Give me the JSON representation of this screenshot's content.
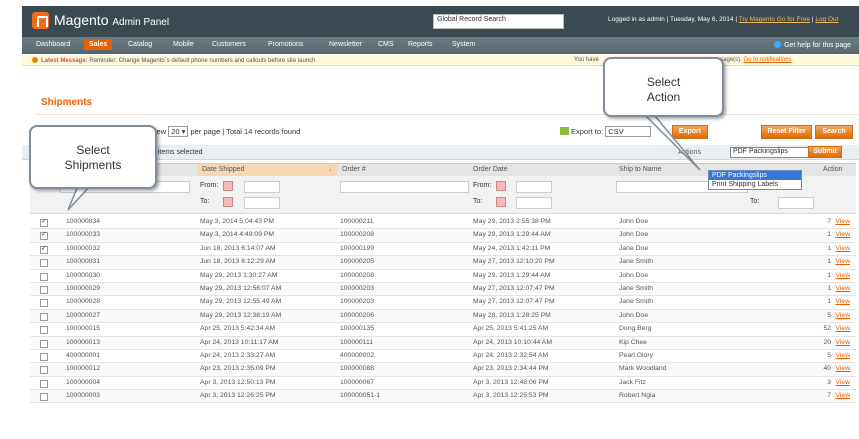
{
  "header": {
    "title": "Magento",
    "title_suffix": "Admin Panel",
    "search_value": "Global Record Search",
    "logged_in": "Logged in as admin",
    "date": "Tuesday, May 6, 2014",
    "try_link": "Try Magento Go for Free",
    "logout": "Log Out"
  },
  "nav": {
    "items": [
      "Dashboard",
      "Sales",
      "Catalog",
      "Mobile",
      "Customers",
      "Promotions",
      "Newsletter",
      "CMS",
      "Reports",
      "System"
    ],
    "active": "Sales",
    "help": "Get help for this page"
  },
  "message": {
    "lead": "Latest Message:",
    "text": "Reminder: Change Magento`s default phone numbers and callouts before site launch",
    "right_text": "You have",
    "right_text2": "unread message(s).",
    "right_link": "Go to notifications"
  },
  "page": {
    "title": "Shipments",
    "pager_view": "View",
    "per_page_value": "20",
    "per_page_label": "per page",
    "total": "Total 14 records found",
    "export_label": "Export to:",
    "export_value": "CSV",
    "export_button": "Export",
    "reset_filter": "Reset Filter",
    "search": "Search",
    "items_selected": "0 items selected",
    "actions_label": "Actions",
    "actions_value": "PDF Packingslips",
    "submit": "Submit",
    "actions_options": [
      "PDF Packingslips",
      "Print Shipping Labels"
    ]
  },
  "grid": {
    "columns": [
      "Date Shipped",
      "Order #",
      "Order Date",
      "Ship to Name",
      "Action"
    ],
    "from_label": "From:",
    "to_label": "To:",
    "rows": [
      {
        "checked": true,
        "id": "100000034",
        "shipped": "May 3, 2014 5:04:43 PM",
        "order": "100000211",
        "order_date": "May 29, 2013 2:55:38 PM",
        "name": "John Doe",
        "qty": "7",
        "action": "View"
      },
      {
        "checked": true,
        "id": "100000033",
        "shipped": "May 3, 2014 4:49:09 PM",
        "order": "100000208",
        "order_date": "May 29, 2013 1:29:44 AM",
        "name": "John Doe",
        "qty": "1",
        "action": "View"
      },
      {
        "checked": true,
        "id": "100000032",
        "shipped": "Jun 18, 2013 6:14:07 AM",
        "order": "100000199",
        "order_date": "May 24, 2013 1:42:11 PM",
        "name": "Jane Doe",
        "qty": "1",
        "action": "View"
      },
      {
        "checked": false,
        "id": "100000031",
        "shipped": "Jun 18, 2013 6:12:29 AM",
        "order": "100000205",
        "order_date": "May 27, 2013 12:10:20 PM",
        "name": "Jane Smith",
        "qty": "1",
        "action": "View"
      },
      {
        "checked": false,
        "id": "100000030",
        "shipped": "May 29, 2013 1:30:27 AM",
        "order": "100000208",
        "order_date": "May 29, 2013 1:29:44 AM",
        "name": "John Doe",
        "qty": "1",
        "action": "View"
      },
      {
        "checked": false,
        "id": "100000029",
        "shipped": "May 29, 2013 12:56:07 AM",
        "order": "100000203",
        "order_date": "May 27, 2013 12:07:47 PM",
        "name": "Jane Smith",
        "qty": "1",
        "action": "View"
      },
      {
        "checked": false,
        "id": "100000028",
        "shipped": "May 29, 2013 12:55:49 AM",
        "order": "100000203",
        "order_date": "May 27, 2013 12:07:47 PM",
        "name": "Jane Smith",
        "qty": "1",
        "action": "View"
      },
      {
        "checked": false,
        "id": "100000027",
        "shipped": "May 29, 2013 12:38:19 AM",
        "order": "100000206",
        "order_date": "May 28, 2013 1:28:25 PM",
        "name": "John Doe",
        "qty": "5",
        "action": "View"
      },
      {
        "checked": false,
        "id": "100000015",
        "shipped": "Apr 25, 2013 5:42:34 AM",
        "order": "100000135",
        "order_date": "Apr 25, 2013 5:41:25 AM",
        "name": "Dong Berg",
        "qty": "52",
        "action": "View"
      },
      {
        "checked": false,
        "id": "100000013",
        "shipped": "Apr 24, 2013 10:11:17 AM",
        "order": "100000111",
        "order_date": "Apr 24, 2013 10:10:44 AM",
        "name": "Kip Chee",
        "qty": "20",
        "action": "View"
      },
      {
        "checked": false,
        "id": "400000001",
        "shipped": "Apr 24, 2013 2:33:27 AM",
        "order": "400000002",
        "order_date": "Apr 24, 2013 2:32:54 AM",
        "name": "Pearl Glory",
        "qty": "5",
        "action": "View"
      },
      {
        "checked": false,
        "id": "100000012",
        "shipped": "Apr 23, 2013 2:35:09 PM",
        "order": "100000088",
        "order_date": "Apr 23, 2013 2:34:44 PM",
        "name": "Mark Woodland",
        "qty": "40",
        "action": "View"
      },
      {
        "checked": false,
        "id": "100000004",
        "shipped": "Apr 3, 2013 12:50:13 PM",
        "order": "100000067",
        "order_date": "Apr 3, 2013 12:48:06 PM",
        "name": "Jack Fitz",
        "qty": "3",
        "action": "View"
      },
      {
        "checked": false,
        "id": "100000003",
        "shipped": "Apr 3, 2013 12:26:25 PM",
        "order": "100000051-1",
        "order_date": "Apr 3, 2013 12:25:53 PM",
        "name": "Robert Ngia",
        "qty": "7",
        "action": "View"
      }
    ]
  },
  "callouts": {
    "select_action": "Select Action",
    "select_shipments": "Select Shipments"
  },
  "colors": {
    "accent": "#eb5e00",
    "header_bg": "#3b4a50",
    "nav_bg": "#5f6f75"
  }
}
